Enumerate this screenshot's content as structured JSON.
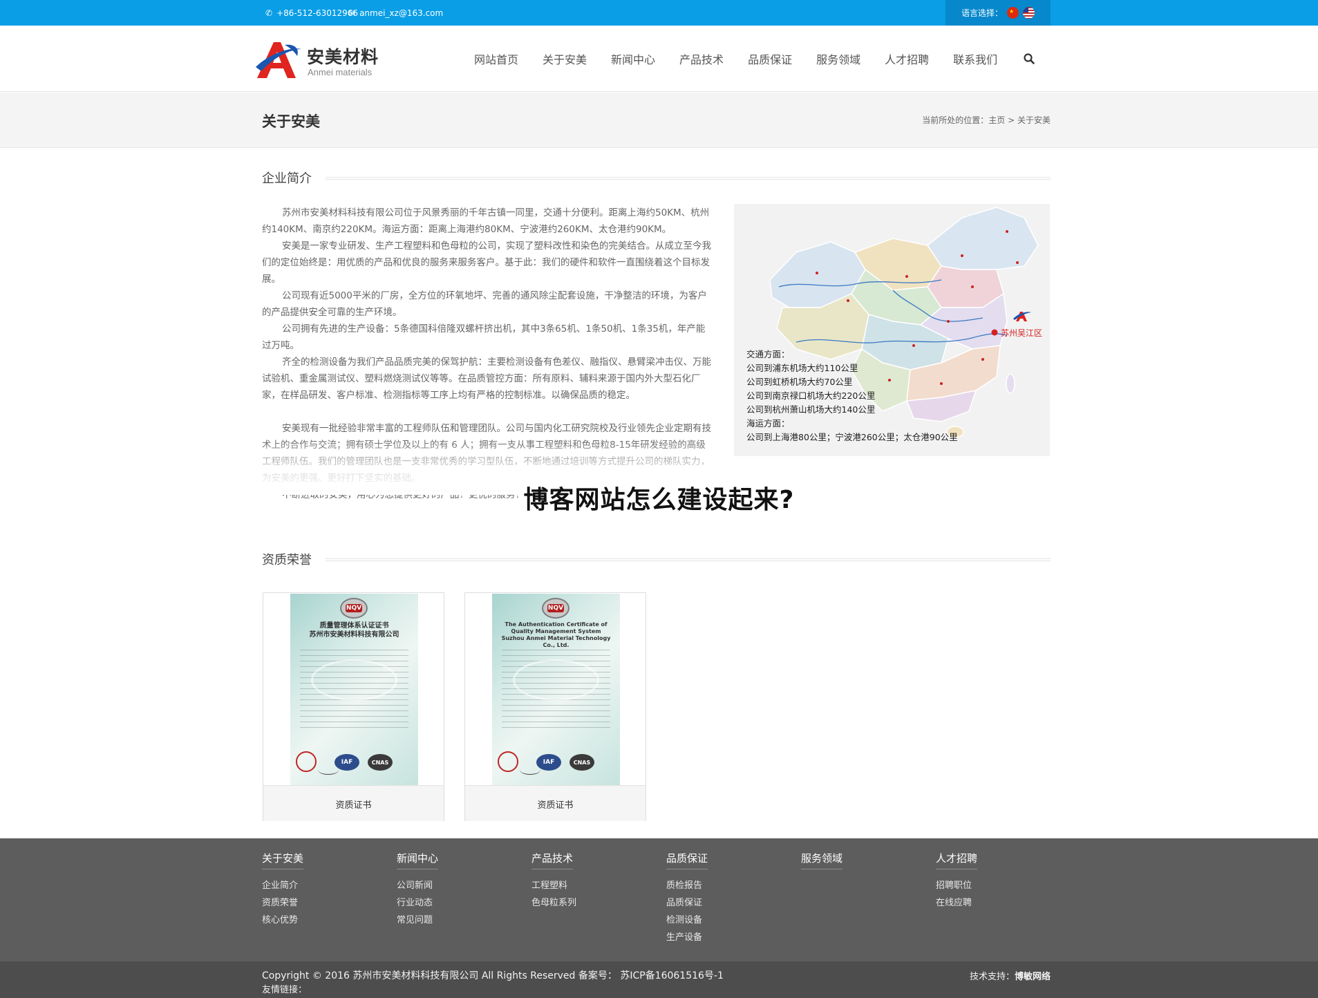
{
  "topbar": {
    "phone": "+86-512-63012966",
    "email": "anmei_xz@163.com",
    "language_label": "语言选择："
  },
  "logo": {
    "cn": "安美材料",
    "en": "Anmei materials"
  },
  "nav": {
    "items": [
      "网站首页",
      "关于安美",
      "新闻中心",
      "产品技术",
      "品质保证",
      "服务领域",
      "人才招聘",
      "联系我们"
    ]
  },
  "title_band": {
    "title": "关于安美",
    "breadcrumb_prefix": "当前所处的位置：",
    "breadcrumb_home": "主页",
    "breadcrumb_sep": " > ",
    "breadcrumb_current": "关于安美"
  },
  "intro": {
    "heading": "企业简介",
    "paragraphs": [
      "苏州市安美材料科技有限公司位于风景秀丽的千年古镇一同里，交通十分便利。距离上海约50KM、杭州约140KM、南京约220KM。海运方面：距离上海港约80KM、宁波港约260KM、太仓港约90KM。",
      "安美是一家专业研发、生产工程塑料和色母粒的公司，实现了塑料改性和染色的完美结合。从成立至今我们的定位始终是：用优质的产品和优良的服务来服务客户。基于此：我们的硬件和软件一直围绕着这个目标发展。",
      "公司现有近5000平米的厂房，全方位的环氧地坪、完善的通风除尘配套设施，干净整洁的环境，为客户的产品提供安全可靠的生产环境。",
      "公司拥有先进的生产设备：5条德国科倍隆双螺杆挤出机，其中3条65机、1条50机、1条35机，年产能过万吨。",
      "齐全的检测设备为我们产品品质完美的保驾护航：主要检测设备有色差仪、融指仪、悬臂梁冲击仪、万能试验机、重金属测试仪、塑料燃烧测试仪等等。在品质管控方面：所有原料、辅料来源于国内外大型石化厂家，在样品研发、客户标准、检测指标等工序上均有严格的控制标准。以确保品质的稳定。",
      "安美现有一批经验非常丰富的工程师队伍和管理团队。公司与国内化工研究院校及行业领先企业定期有技术上的合作与交流；拥有硕士学位及以上的有 6 人；拥有一支从事工程塑料和色母粒8-15年研发经验的高级工程师队伍。我们的管理团队也是一支非常优秀的学习型队伍，不断地通过培训等方式提升公司的梯队实力，为安美的更强、更好打下坚实的基础。",
      "不断进取的安美，用心为您提供更好的产品！更优的服务！"
    ]
  },
  "map": {
    "location_label": "苏州吴江区",
    "info_lines": [
      "交通方面：",
      "公司到浦东机场大约110公里",
      "公司到虹桥机场大约70公里",
      "公司到南京禄口机场大约220公里",
      "公司到杭州萧山机场大约140公里",
      "海运方面：",
      "公司到上海港80公里；宁波港260公里；太仓港90公里"
    ]
  },
  "overlay_title": "博客网站怎么建设起来?",
  "honors": {
    "heading": "资质荣誉",
    "items": [
      {
        "caption": "资质证书",
        "cert_title": "质量管理体系认证证书",
        "cert_company": "苏州市安美材料科技有限公司",
        "badge": "NQV"
      },
      {
        "caption": "资质证书",
        "cert_title": "The Authentication Certificate of Quality Management System",
        "cert_company": "Suzhou Anmei Material Technology Co., Ltd.",
        "badge": "NQV"
      }
    ],
    "seal_labels": [
      "IAF",
      "CNAS"
    ]
  },
  "footer": {
    "columns": [
      {
        "title": "关于安美",
        "links": [
          "企业简介",
          "资质荣誉",
          "核心优势"
        ]
      },
      {
        "title": "新闻中心",
        "links": [
          "公司新闻",
          "行业动态",
          "常见问题"
        ]
      },
      {
        "title": "产品技术",
        "links": [
          "工程塑料",
          "色母粒系列"
        ]
      },
      {
        "title": "品质保证",
        "links": [
          "质检报告",
          "品质保证",
          "检测设备",
          "生产设备"
        ]
      },
      {
        "title": "服务领域",
        "links": []
      },
      {
        "title": "人才招聘",
        "links": [
          "招聘职位",
          "在线应聘"
        ]
      }
    ],
    "copyright": "Copyright © 2016 苏州市安美材料科技有限公司 All Rights Reserved 备案号： 苏ICP备16061516号-1",
    "friend_links": "友情链接：",
    "tech_prefix": "技术支持：",
    "tech_name": "博敏网络"
  },
  "colors": {
    "topbar": "#0a9ee6",
    "footer": "#5d5d5d",
    "bottombar": "#4d4d4d",
    "logo_red": "#e0241f",
    "logo_blue": "#1a56b0",
    "map_marker": "#d42020"
  },
  "icons": [
    "phone-icon",
    "mail-icon",
    "search-icon",
    "flag-cn-icon",
    "flag-us-icon"
  ]
}
